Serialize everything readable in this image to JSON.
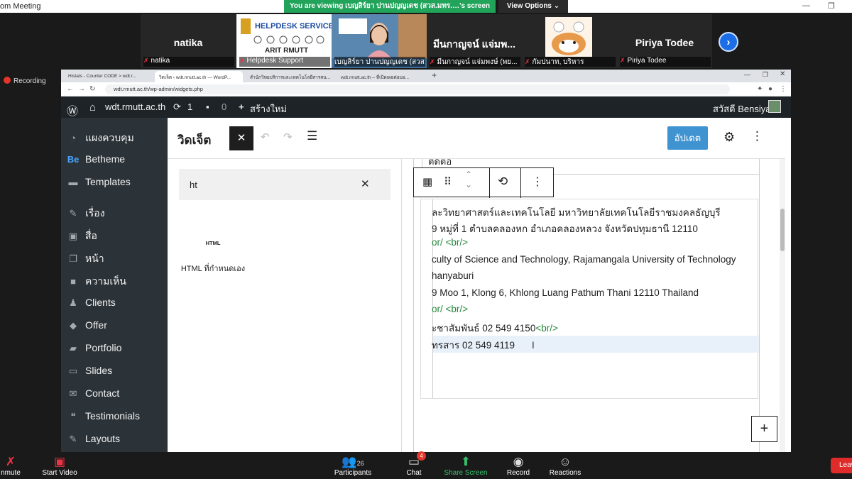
{
  "zoom": {
    "window_title": "om Meeting",
    "banner_viewing": "You are viewing เบญสิร์ยา ปานปญญเดช (สวส.มทร.…'s screen",
    "view_options": "View Options ⌄",
    "recording": "Recording",
    "participants": [
      {
        "name": "natika",
        "label": "natika"
      },
      {
        "name": "",
        "label": "Helpdesk Support"
      },
      {
        "name": "",
        "label": "เบญสิร์ยา ปานปญญเดช (สวส..."
      },
      {
        "name": "มีนกาญจน์ แจ่มพ...",
        "label": "มีนกาญจน์ แจ่มพงษ์ (พย..."
      },
      {
        "name": "",
        "label": "กัมปนาท, บริหาร"
      },
      {
        "name": "Piriya Todee",
        "label": "Piriya Todee"
      }
    ],
    "helpdesk_line1": "HELPDESK SERVICE",
    "helpdesk_line2": "ARIT RMUTT",
    "toolbar": {
      "mute": "nmute",
      "start_video": "Start Video",
      "participants": "Participants",
      "participants_count": "26",
      "chat": "Chat",
      "chat_badge": "4",
      "share": "Share Screen",
      "record": "Record",
      "reactions": "Reactions",
      "leave": "Leav"
    }
  },
  "browser": {
    "tabs": [
      "Histats - Counter CODE > wdt.r...",
      "วิดเจ็ต ‹ wdt.rmutt.ac.th — WordP...",
      "สำนักวิทยบริการและเทคโนโลยีสารสน...",
      "wdt.rmutt.ac.th – ที่เปิดเผยต่อบอ..."
    ],
    "url": "wdt.rmutt.ac.th/wp-admin/widgets.php"
  },
  "wp": {
    "site": "wdt.rmutt.ac.th",
    "updates": "1",
    "comments": "0",
    "new": "สร้างใหม่",
    "greeting": "สวัสดี Bensiya",
    "menu": [
      {
        "label": "แผงควบคุม",
        "icon": "dashboard-icon",
        "glyph": "◔"
      },
      {
        "label": "Betheme",
        "icon": "betheme-icon",
        "glyph": "Be"
      },
      {
        "label": "Templates",
        "icon": "templates-icon",
        "glyph": "▬"
      },
      {
        "label": "เรื่อง",
        "icon": "pin-icon",
        "glyph": "✎"
      },
      {
        "label": "สื่อ",
        "icon": "media-icon",
        "glyph": "▣"
      },
      {
        "label": "หน้า",
        "icon": "page-icon",
        "glyph": "❐"
      },
      {
        "label": "ความเห็น",
        "icon": "comment-icon",
        "glyph": "■"
      },
      {
        "label": "Clients",
        "icon": "clients-icon",
        "glyph": "♟"
      },
      {
        "label": "Offer",
        "icon": "offer-icon",
        "glyph": "◆"
      },
      {
        "label": "Portfolio",
        "icon": "portfolio-icon",
        "glyph": "▰"
      },
      {
        "label": "Slides",
        "icon": "slides-icon",
        "glyph": "▭"
      },
      {
        "label": "Contact",
        "icon": "contact-icon",
        "glyph": "✉"
      },
      {
        "label": "Testimonials",
        "icon": "testimonials-icon",
        "glyph": "❝"
      },
      {
        "label": "Layouts",
        "icon": "layouts-icon",
        "glyph": "✎"
      }
    ]
  },
  "editor": {
    "title": "วิดเจ็ต",
    "update": "อัปเดต",
    "search_value": "ht",
    "block_icon_text": "HTML",
    "block_label": "HTML ที่กำหนดเอง",
    "top_text": "ติดต่อ",
    "lines": [
      {
        "text": "ละวิทยาศาสตร์และเทคโนโลยี มหาวิทยาลัยเทคโนโลยีราชมงคลธัญบุรี",
        "tag": ""
      },
      {
        "text": "9 หมู่ที่ 1 ตำบลคลองหก อำเภอคลองหลวง จังหวัดปทุมธานี 12110",
        "tag": ""
      },
      {
        "text": "or/ ",
        "tag": "<br/>",
        "tag_only": true
      },
      {
        "text": "culty of Science and Technology, Rajamangala University of Technology",
        "tag": ""
      },
      {
        "text": "hanyaburi",
        "tag": ""
      },
      {
        "text": "9 Moo 1, Klong 6, Khlong Luang Pathum Thani 12110 Thailand",
        "tag": ""
      },
      {
        "text": "or/ ",
        "tag": "<br/>",
        "tag_only": true
      },
      {
        "text": "ะชาสัมพันธ์ 02 549 4150",
        "tag": "<br/>"
      },
      {
        "text": "ทรสาร 02 549 4119",
        "tag": ""
      }
    ]
  }
}
